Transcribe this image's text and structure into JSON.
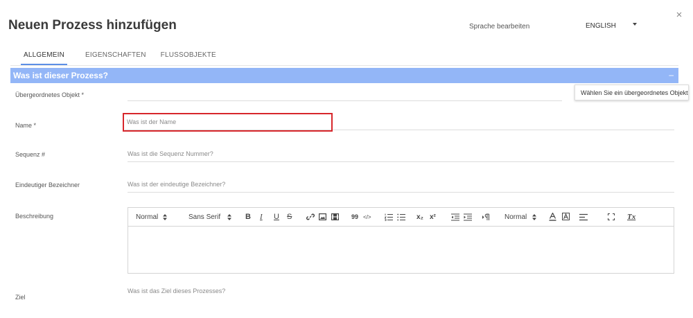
{
  "dialog": {
    "title": "Neuen Prozess hinzufügen"
  },
  "language": {
    "label": "Sprache bearbeiten",
    "selected": "ENGLISH"
  },
  "tabs": [
    {
      "label": "ALLGEMEIN",
      "active": true
    },
    {
      "label": "EIGENSCHAFTEN",
      "active": false
    },
    {
      "label": "FLUSSOBJEKTE",
      "active": false
    }
  ],
  "section": {
    "title": "Was ist dieser Prozess?",
    "toggle": "–"
  },
  "fields": {
    "parent": {
      "label": "Übergeordnetes Objekt  *",
      "value": "",
      "tooltip": "Wählen Sie ein übergeordnetes Objekt"
    },
    "name": {
      "label": "Name *",
      "placeholder": "Was ist der Name"
    },
    "sequence": {
      "label": "Sequenz #",
      "placeholder": "Was ist die Sequenz Nummer?"
    },
    "identifier": {
      "label": "Eindeutiger Bezeichner",
      "placeholder": "Was ist der eindeutige Bezeichner?"
    },
    "description": {
      "label": "Beschreibung"
    },
    "goal": {
      "label": "Ziel",
      "placeholder": "Was ist das Ziel dieses Prozesses?"
    }
  },
  "editor_toolbar": {
    "header_select": "Normal",
    "font_select": "Sans Serif",
    "size_select": "Normal",
    "quote_glyph": "99",
    "code_glyph": "</>",
    "subscript_glyph": "x₂",
    "superscript_glyph": "x²",
    "bold_glyph": "B",
    "italic_glyph": "I",
    "underline_glyph": "U",
    "strike_glyph": "S",
    "clean_glyph": "Tx"
  },
  "colors": {
    "accent": "#5b8fe6",
    "section_bar": "#93b6f7",
    "highlight": "#d7262b"
  }
}
